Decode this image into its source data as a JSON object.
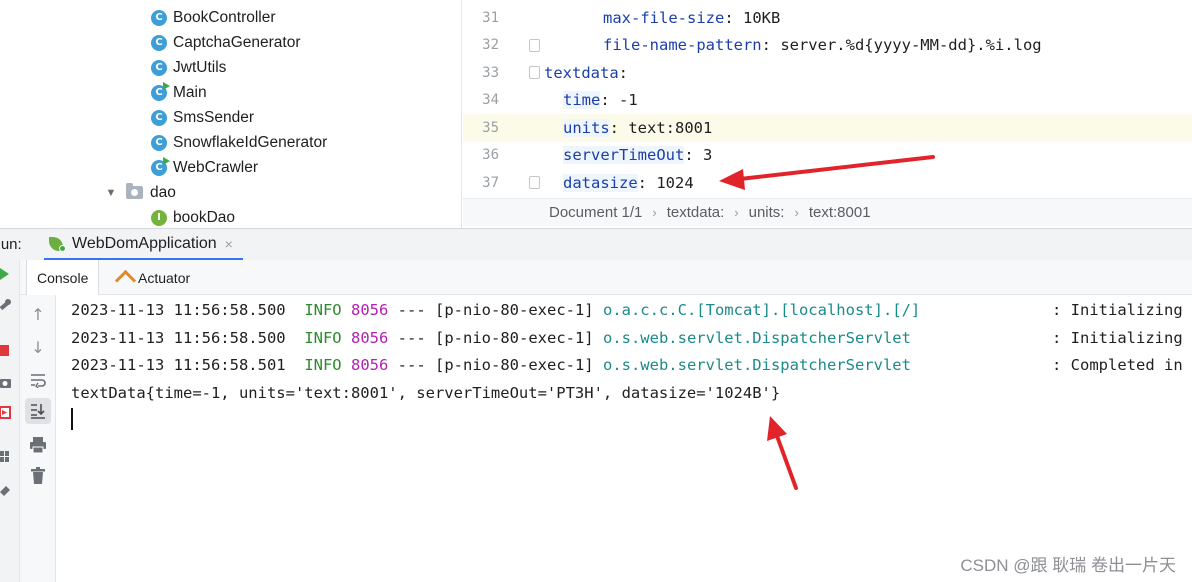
{
  "tree": {
    "items": [
      {
        "label": "BookController",
        "icon": "class-icon"
      },
      {
        "label": "CaptchaGenerator",
        "icon": "class-icon"
      },
      {
        "label": "JwtUtils",
        "icon": "class-icon"
      },
      {
        "label": "Main",
        "icon": "runnable-class-icon"
      },
      {
        "label": "SmsSender",
        "icon": "class-icon"
      },
      {
        "label": "SnowflakeIdGenerator",
        "icon": "class-icon"
      },
      {
        "label": "WebCrawler",
        "icon": "runnable-class-icon"
      },
      {
        "label": "dao",
        "icon": "folder-icon"
      },
      {
        "label": "bookDao",
        "icon": "interface-icon"
      }
    ],
    "class_icon_letter": "C",
    "interface_icon_letter": "I"
  },
  "editor": {
    "lines": [
      {
        "num": "31",
        "key": "max-file-size",
        "value": " 10KB"
      },
      {
        "num": "32",
        "key": "file-name-pattern",
        "value": " server.%d{yyyy-MM-dd}.%i.log"
      },
      {
        "num": "33",
        "key": "textdata",
        "value": ""
      },
      {
        "num": "34",
        "key": "time",
        "value": " -1"
      },
      {
        "num": "35",
        "key": "units",
        "value": " text:8001"
      },
      {
        "num": "36",
        "key": "serverTimeOut",
        "value": " 3"
      },
      {
        "num": "37",
        "key": "datasize",
        "value": " 1024"
      }
    ],
    "colon": ":",
    "breadcrumb": [
      "Document 1/1",
      "textdata:",
      "units:",
      "text:8001"
    ],
    "breadcrumb_sep": "›"
  },
  "run": {
    "label": "Run:",
    "tab_title": "WebDomApplication",
    "tab_close": "×",
    "subtabs": [
      "Console",
      "Actuator"
    ]
  },
  "console": {
    "lines": [
      {
        "ts": "2023-11-13 11:56:58.500",
        "level": "INFO",
        "pid": "8056",
        "sep": "---",
        "thread": "[p-nio-80-exec-1]",
        "logger": "o.a.c.c.C.[Tomcat].[localhost].[/]",
        "msg": ": Initializing"
      },
      {
        "ts": "2023-11-13 11:56:58.500",
        "level": "INFO",
        "pid": "8056",
        "sep": "---",
        "thread": "[p-nio-80-exec-1]",
        "logger": "o.s.web.servlet.DispatcherServlet",
        "msg": ": Initializing"
      },
      {
        "ts": "2023-11-13 11:56:58.501",
        "level": "INFO",
        "pid": "8056",
        "sep": "---",
        "thread": "[p-nio-80-exec-1]",
        "logger": "o.s.web.servlet.DispatcherServlet",
        "msg": ": Completed in"
      }
    ],
    "output": "textData{time=-1, units='text:8001', serverTimeOut='PT3H', datasize='1024B'}"
  },
  "toolbar_icons": [
    "up-arrow-icon",
    "down-arrow-icon",
    "soft-wrap-icon",
    "scroll-to-end-icon",
    "print-icon",
    "trash-icon"
  ],
  "annotation_color": "#e0242a",
  "watermark": "CSDN @跟 耿瑞 卷出一片天"
}
